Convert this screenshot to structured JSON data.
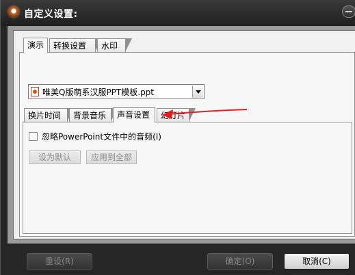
{
  "window": {
    "title": "自定义设置:"
  },
  "tabs_outer": [
    "演示",
    "转换设置",
    "水印"
  ],
  "file_select": {
    "value": "唯美Q版萌系汉服PPT模板.ppt"
  },
  "tabs_inner": [
    "换片时间",
    "背景音乐",
    "声音设置",
    "幻灯片"
  ],
  "sound_settings": {
    "ignore_audio_label": "忽略PowerPoint文件中的音频(I)",
    "ignore_audio_checked": false,
    "set_default_label": "设为默认",
    "apply_all_label": "应用到全部"
  },
  "footer": {
    "reset_label": "重设(R)",
    "ok_label": "确定(O)",
    "cancel_label": "取消(C)"
  },
  "annotation": {
    "arrow_color": "#e02020"
  }
}
